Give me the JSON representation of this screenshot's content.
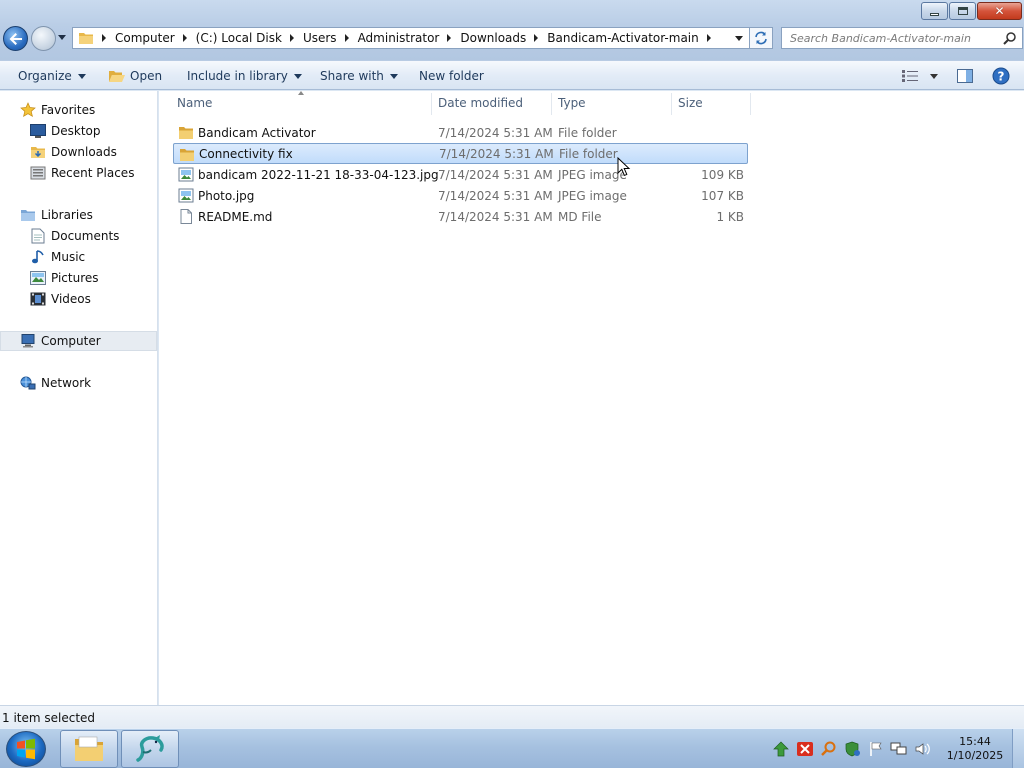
{
  "window": {
    "minimize_icon": "minimize-icon",
    "restore_icon": "restore-icon",
    "close_label": "✕"
  },
  "address_bar": {
    "breadcrumbs": [
      "Computer",
      "(C:) Local Disk",
      "Users",
      "Administrator",
      "Downloads",
      "Bandicam-Activator-main"
    ]
  },
  "search": {
    "placeholder": "Search Bandicam-Activator-main"
  },
  "toolbar": {
    "organize": "Organize",
    "open": "Open",
    "include_in_library": "Include in library",
    "share_with": "Share with",
    "new_folder": "New folder"
  },
  "nav_pane": {
    "favorites": "Favorites",
    "desktop": "Desktop",
    "downloads": "Downloads",
    "recent_places": "Recent Places",
    "libraries": "Libraries",
    "documents": "Documents",
    "music": "Music",
    "pictures": "Pictures",
    "videos": "Videos",
    "computer": "Computer",
    "network": "Network"
  },
  "columns": {
    "name": "Name",
    "date_modified": "Date modified",
    "type": "Type",
    "size": "Size"
  },
  "files": [
    {
      "name": "Bandicam Activator",
      "date": "7/14/2024 5:31 AM",
      "type": "File folder",
      "size": "",
      "icon": "folder-icon"
    },
    {
      "name": "Connectivity fix",
      "date": "7/14/2024 5:31 AM",
      "type": "File folder",
      "size": "",
      "icon": "folder-icon",
      "selected": true
    },
    {
      "name": "bandicam 2022-11-21 18-33-04-123.jpg",
      "date": "7/14/2024 5:31 AM",
      "type": "JPEG image",
      "size": "109 KB",
      "icon": "image-file-icon"
    },
    {
      "name": "Photo.jpg",
      "date": "7/14/2024 5:31 AM",
      "type": "JPEG image",
      "size": "107 KB",
      "icon": "image-file-icon"
    },
    {
      "name": "README.md",
      "date": "7/14/2024 5:31 AM",
      "type": "MD File",
      "size": "1 KB",
      "icon": "document-file-icon"
    }
  ],
  "status_bar": {
    "text": "1 item selected"
  },
  "taskbar": {
    "time": "15:44",
    "date": "1/10/2025"
  },
  "colors": {
    "selection_bg": "#cce4fc",
    "selection_border": "#7da2ce",
    "taskbar": "#a6c1e0"
  }
}
